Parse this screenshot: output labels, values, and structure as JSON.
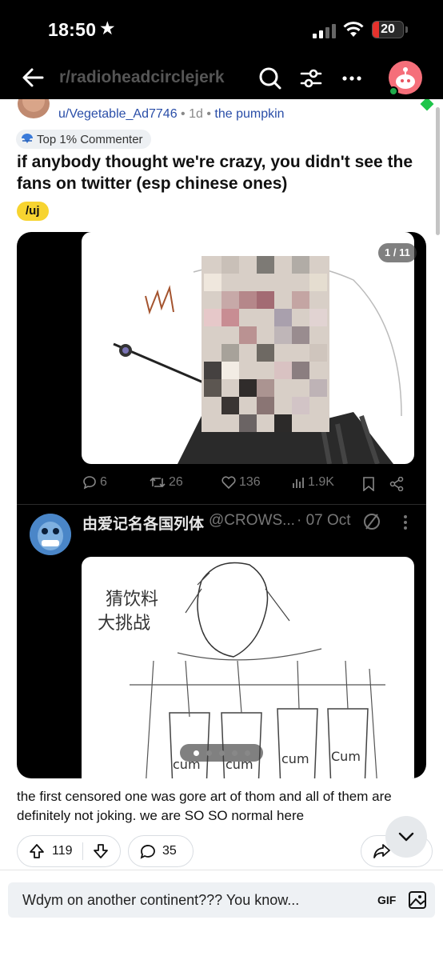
{
  "status_bar": {
    "time": "18:50",
    "battery": "20"
  },
  "nav": {
    "title": "r/radioheadcirclejerk"
  },
  "post": {
    "author": "u/Vegetable_Ad7746",
    "age": "1d",
    "user_flair": "the pumpkin",
    "badge": "Top 1% Commenter",
    "title": "if anybody thought we're crazy, you didn't see the fans on twitter (esp chinese ones)",
    "tag": "/uj",
    "body": "the first censored one was gore art of thom and all of them are definitely not joking. we are SO SO normal here"
  },
  "media": {
    "counter": "1 / 11",
    "tweet_stats": {
      "replies": "6",
      "retweets": "26",
      "likes": "136",
      "views": "1.9K"
    },
    "tweet": {
      "name": "由爱记名各国列体",
      "handle": "@CROWS...",
      "date": "· 07 Oct"
    },
    "image_texts": [
      "cum",
      "cum",
      "cum",
      "Cum"
    ],
    "handwriting": [
      "猜饮料",
      "大挑战"
    ]
  },
  "actions": {
    "upvotes": "119",
    "comments": "35",
    "share": ""
  },
  "composer": {
    "placeholder": "Wdym on another continent??? You know...",
    "gif_label": "GIF"
  }
}
